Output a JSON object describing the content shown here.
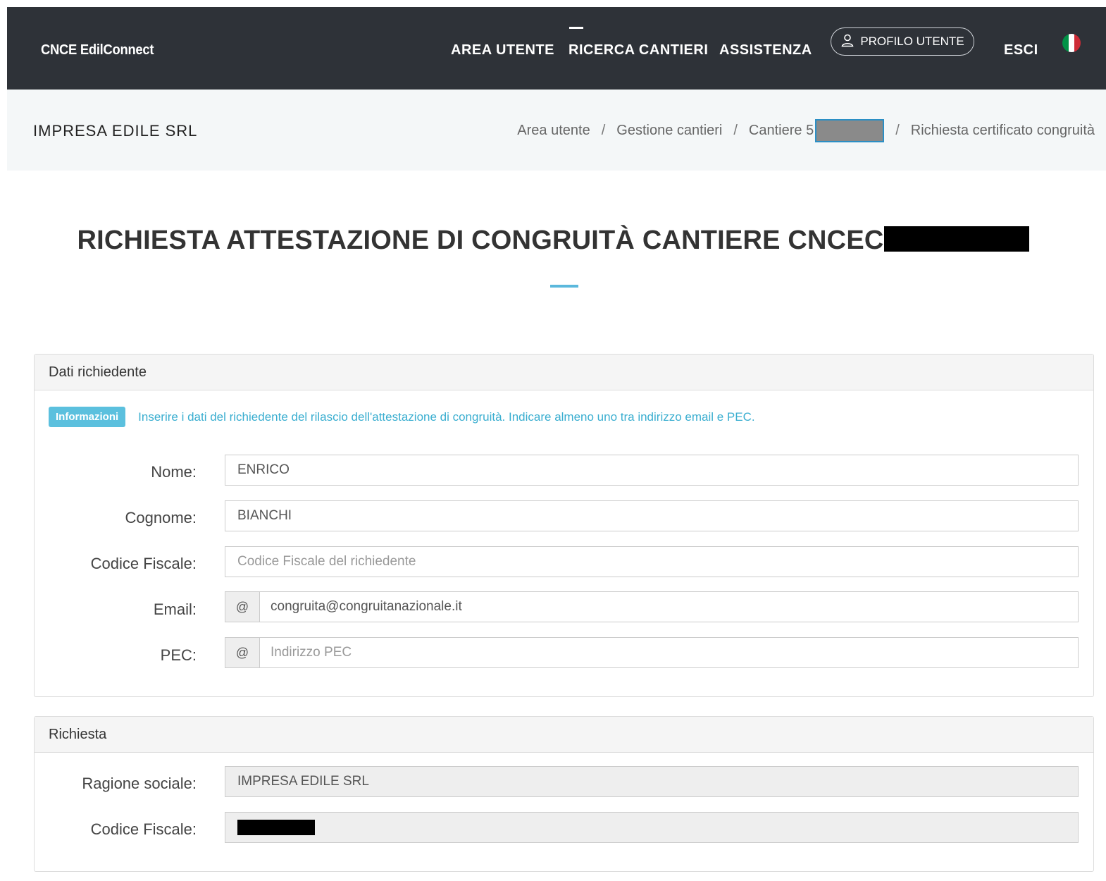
{
  "navbar": {
    "brand": "CNCE EdilConnect",
    "items": [
      "AREA UTENTE",
      "RICERCA CANTIERI",
      "ASSISTENZA"
    ],
    "profile_label": "PROFILO UTENTE",
    "logout_label": "ESCI",
    "flag_colors": [
      "#009246",
      "#ffffff",
      "#ce2b37"
    ]
  },
  "subbar": {
    "company": "IMPRESA EDILE SRL",
    "breadcrumb": [
      "Area utente",
      "Gestione cantieri",
      "Cantiere 5",
      "Richiesta certificato congruità"
    ],
    "separator": "/"
  },
  "title": "RICHIESTA ATTESTAZIONE DI CONGRUITÀ CANTIERE CNCEC",
  "richiedente": {
    "heading": "Dati richiedente",
    "badge": "Informazioni",
    "info": "Inserire i dati del richiedente del rilascio dell'attestazione di congruità. Indicare almeno uno tra indirizzo email e PEC.",
    "nome_label": "Nome:",
    "nome_value": "ENRICO",
    "cognome_label": "Cognome:",
    "cognome_value": "BIANCHI",
    "cf_label": "Codice Fiscale:",
    "cf_placeholder": "Codice Fiscale del richiedente",
    "email_label": "Email:",
    "email_addon": "@",
    "email_value": "congruita@congruitanazionale.it",
    "pec_label": "PEC:",
    "pec_addon": "@",
    "pec_placeholder": "Indirizzo PEC"
  },
  "richiesta": {
    "heading": "Richiesta",
    "ragione_label": "Ragione sociale:",
    "ragione_value": "IMPRESA EDILE SRL",
    "cf_label": "Codice Fiscale:"
  },
  "colors": {
    "navbar_bg": "#2e3238",
    "accent": "#5bb8dc",
    "info_text": "#3aaed0",
    "badge_bg": "#5bc0de"
  }
}
